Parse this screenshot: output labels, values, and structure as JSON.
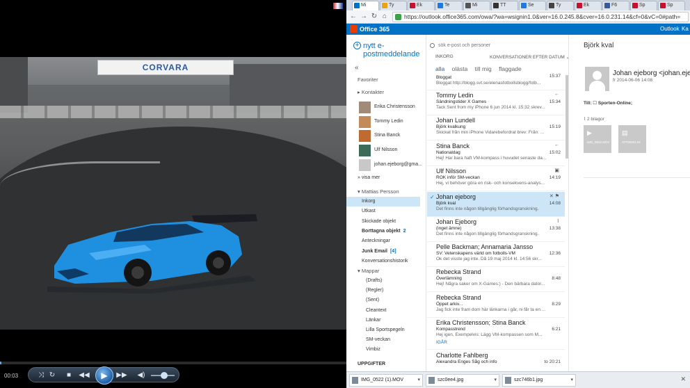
{
  "player": {
    "time": "00:03",
    "banner_text": "CORVARA",
    "progress_fraction": 0.004,
    "volume_fraction": 0.55
  },
  "browser": {
    "tabs": [
      {
        "label": "Mi",
        "active": true,
        "color": "#0072c6"
      },
      {
        "label": "Ty",
        "active": false,
        "color": "#e8a317"
      },
      {
        "label": "Ek",
        "active": false,
        "color": "#c8102e"
      },
      {
        "label": "Te",
        "active": false,
        "color": "#1f7ae0"
      },
      {
        "label": "Mi",
        "active": false,
        "color": "#555555"
      },
      {
        "label": "TT",
        "active": false,
        "color": "#333333"
      },
      {
        "label": "Se",
        "active": false,
        "color": "#1f7ae0"
      },
      {
        "label": "Ty",
        "active": false,
        "color": "#444444"
      },
      {
        "label": "Ek",
        "active": false,
        "color": "#c8102e"
      },
      {
        "label": "F6",
        "active": false,
        "color": "#3b5998"
      },
      {
        "label": "Sp",
        "active": false,
        "color": "#c8102e"
      },
      {
        "label": "Sp",
        "active": false,
        "color": "#c8102e"
      }
    ],
    "url": "https://outlook.office365.com/owa/?wa=wsignin1.0&ver=16.0.245.8&cver=16.0.231.14&cf=0&vC=0#path=",
    "brand": "Office 365",
    "nav": [
      "Outlook",
      "Ka"
    ]
  },
  "folders": {
    "new_mail": "nytt e-postmeddelande",
    "favorites": "Favoriter",
    "contacts_header": "Kontakter",
    "contacts": [
      "Erika Christensson",
      "Tommy Ledin",
      "Stina Banck",
      "Ulf Nilsson",
      "johan.ejeborg@gma..."
    ],
    "show_more": "visa mer",
    "account": "Mattias Persson",
    "items": [
      {
        "label": "Inkorg",
        "bold": false,
        "count": ""
      },
      {
        "label": "Utkast",
        "bold": false,
        "count": ""
      },
      {
        "label": "Skickade objekt",
        "bold": false,
        "count": ""
      },
      {
        "label": "Borttagna objekt",
        "bold": true,
        "count": "2"
      },
      {
        "label": "Anteckningar",
        "bold": false,
        "count": ""
      },
      {
        "label": "Junk Email",
        "bold": true,
        "count": "[4]"
      },
      {
        "label": "Konversationshistorik",
        "bold": false,
        "count": ""
      }
    ],
    "folders_header": "Mappar",
    "subfolders": [
      "(Drafts)",
      "(Regler)",
      "(Sent)",
      "Cleantext",
      "Länkar",
      "Lilla Sportspegeln",
      "SM-veckan",
      "Vimbiz"
    ],
    "tasks": "UPPGIFTER"
  },
  "list": {
    "search_placeholder": "sök e-post och personer",
    "folder": "INKORG",
    "sort": "KONVERSATIONER EFTER DATUM",
    "filters": [
      "alla",
      "olästa",
      "till mig",
      "flaggade"
    ],
    "messages": [
      {
        "from": "",
        "subject": "Bloggat",
        "preview": "Bloggat http://blogg.svt.se/elenasfotbollsblogg/fotb...",
        "time": "15:37",
        "icon": ""
      },
      {
        "from": "Tommy Ledin",
        "subject": "Sändningstider X Games",
        "preview": "Tack  Sent from my iPhone  6 jun 2014 kl. 15:32 skrev...",
        "time": "15:34",
        "icon": "←"
      },
      {
        "from": "Johan Lundell",
        "subject": "Björk kvalkung",
        "preview": "Skickat från min iPhone  Vidarebefordrat brev:  Från: ...",
        "time": "15:19",
        "icon": ""
      },
      {
        "from": "Stina Banck",
        "subject": "Nationaldag",
        "preview": "Hej! Har bara haft VM-kompass i huvudet senaste da...",
        "time": "15:02",
        "icon": "←"
      },
      {
        "from": "Ulf Nilsson",
        "subject": "ROK inför SM-veckan",
        "preview": "Hej,  vi behöver göra en risk- och konsekvens-analys...",
        "time": "14:19",
        "icon": "▣"
      },
      {
        "from": "Johan ejeborg",
        "subject": "Björk kval",
        "preview": "Det finns inte någon tillgänglig förhandsgranskning.",
        "time": "14:08",
        "icon": "✕ ⚑",
        "selected": true
      },
      {
        "from": "Johan Ejeborg",
        "subject": "(inget ämne)",
        "preview": "Det finns inte någon tillgänglig förhandsgranskning.",
        "time": "13:38",
        "icon": "⌇"
      },
      {
        "from": "Pelle Backman; Annamaria Jansso",
        "subject": "SV: Vetenskapens värld om fotbolls-VM",
        "preview": "Ok det visste jag inte. Då  19 maj 2014 kl. 14:56 skr...",
        "time": "12:36",
        "icon": ""
      },
      {
        "from": "Rebecka Strand",
        "subject": "Överlämning",
        "preview": "Hej!  Några saker om X-Games:)  - Den bärbara dator...",
        "time": "8:48",
        "icon": ""
      },
      {
        "from": "Rebecka Strand",
        "subject": "Öppet arkiv...",
        "preview": "Jag fick inte fram dom här länkarna i går, ni får ta en ...",
        "time": "8:29",
        "icon": ""
      },
      {
        "from": "Erika Christensson; Stina Banck",
        "subject": "Kompasstrend",
        "preview": "Hej igen,  Exempelvis:  Lägg VM-kompassen som M...",
        "time": "6:21",
        "icon": "",
        "link": "IGÅR"
      },
      {
        "from": "Charlotte Fahlberg",
        "subject": "Alexandra Enges Såg och info",
        "preview": "",
        "time": "to 20:21",
        "icon": ""
      }
    ]
  },
  "reading": {
    "subject": "Björk kval",
    "from": "Johan ejeborg <johan.ejeb",
    "date": "fr 2014-06-06 14:08",
    "to_label": "Till:",
    "to_value": "Sporten-Online;",
    "attachments_label": "2 bilagor",
    "attachments": [
      {
        "name": "IMG_0522.MOV",
        "icon": "▶"
      },
      {
        "name": "ATT00001.txt",
        "icon": "▤"
      }
    ]
  },
  "downloads": {
    "items": [
      "IMG_0522 (1).MOV",
      "szc0ee4.jpg",
      "szc746b1.jpg"
    ],
    "close": "✕"
  }
}
